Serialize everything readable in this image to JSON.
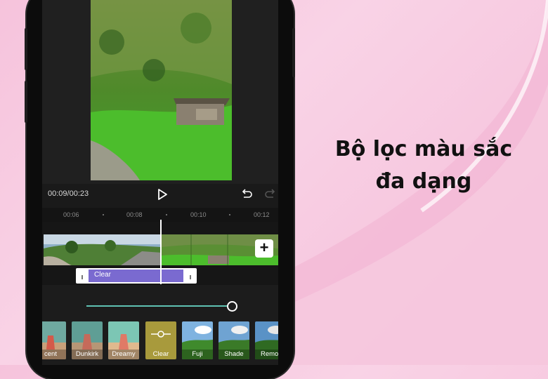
{
  "player": {
    "current_time": "00:09",
    "separator": "/",
    "total_time": "00:23"
  },
  "ruler": [
    "00:06",
    "00:08",
    "00:10",
    "00:12"
  ],
  "timeline": {
    "filter_track_label": "Clear",
    "add_button_label": "+"
  },
  "adjust_slider": {
    "value_fraction": 1.0
  },
  "filters": {
    "items": [
      {
        "label": "Recent",
        "visible_label": "cent"
      },
      {
        "label": "Dunkirk"
      },
      {
        "label": "Dreamy"
      },
      {
        "label": "Clear",
        "selected": true
      },
      {
        "label": "Fuji"
      },
      {
        "label": "Shade"
      },
      {
        "label": "Remote",
        "visible_label": "Remot"
      }
    ]
  },
  "headline": {
    "line1": "Bộ lọc màu sắc",
    "line2": "đa dạng"
  },
  "colors": {
    "background_pink": "#f6c3dc",
    "accent_teal": "#5fc2b3",
    "filter_track_purple": "#7a6ad0",
    "selected_filter": "#a89a3c"
  }
}
